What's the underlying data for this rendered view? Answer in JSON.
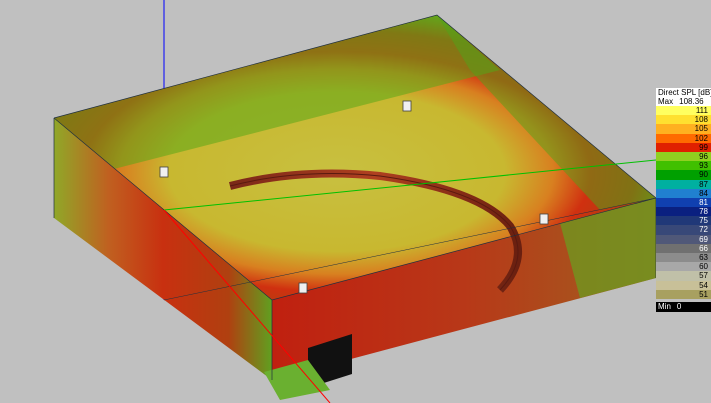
{
  "legend": {
    "title": "Direct SPL [dB]",
    "max_label": "Max",
    "max_value": "108.36",
    "min_label": "Min",
    "min_value": "0",
    "levels": [
      {
        "value": "111",
        "color": "#ffff60",
        "text": "#000000"
      },
      {
        "value": "108",
        "color": "#ffe030",
        "text": "#000000"
      },
      {
        "value": "105",
        "color": "#ffb020",
        "text": "#000000"
      },
      {
        "value": "102",
        "color": "#ff6a00",
        "text": "#000000"
      },
      {
        "value": "99",
        "color": "#e02000",
        "text": "#000000"
      },
      {
        "value": "96",
        "color": "#90d020",
        "text": "#000000"
      },
      {
        "value": "93",
        "color": "#40c000",
        "text": "#000000"
      },
      {
        "value": "90",
        "color": "#00a000",
        "text": "#000000"
      },
      {
        "value": "87",
        "color": "#00b0a0",
        "text": "#000000"
      },
      {
        "value": "84",
        "color": "#2080d0",
        "text": "#000000"
      },
      {
        "value": "81",
        "color": "#1040b0",
        "text": "#ffffff"
      },
      {
        "value": "78",
        "color": "#0a2080",
        "text": "#ffffff"
      },
      {
        "value": "75",
        "color": "#203878",
        "text": "#ffffff"
      },
      {
        "value": "72",
        "color": "#384878",
        "text": "#ffffff"
      },
      {
        "value": "69",
        "color": "#505878",
        "text": "#ffffff"
      },
      {
        "value": "66",
        "color": "#707070",
        "text": "#ffffff"
      },
      {
        "value": "63",
        "color": "#8c8c8c",
        "text": "#000000"
      },
      {
        "value": "60",
        "color": "#a8a8a8",
        "text": "#000000"
      },
      {
        "value": "57",
        "color": "#c0c0a8",
        "text": "#000000"
      },
      {
        "value": "54",
        "color": "#c8c098",
        "text": "#000000"
      },
      {
        "value": "51",
        "color": "#a8a060",
        "text": "#000000"
      }
    ]
  },
  "colors": {
    "background": "#c0c0c0",
    "axis_x": "#ff0000",
    "axis_y": "#00c000",
    "axis_z": "#0000ff",
    "edges": "#203040"
  },
  "speakers": [
    "speaker-icon",
    "speaker-icon",
    "speaker-icon",
    "speaker-icon"
  ]
}
